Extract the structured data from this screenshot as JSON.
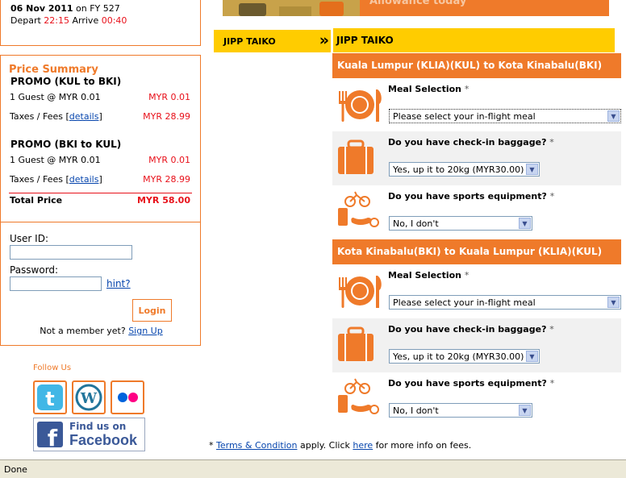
{
  "flight": {
    "date_flight": "06 Nov 2011",
    "on_label": "on",
    "flight_no": "FY 527",
    "depart_label": "Depart",
    "depart_time": "22:15",
    "arrive_label": "Arrive",
    "arrive_time": "00:40"
  },
  "price_summary": {
    "title": "Price Summary",
    "segments": [
      {
        "name": "PROMO (KUL to BKI)",
        "guest_line": "1 Guest @ MYR 0.01",
        "guest_price": "MYR 0.01",
        "taxes_label": "Taxes / Fees [",
        "details_link": "details",
        "taxes_close": "]",
        "taxes_price": "MYR 28.99"
      },
      {
        "name": "PROMO (BKI to KUL)",
        "guest_line": "1 Guest @ MYR 0.01",
        "guest_price": "MYR 0.01",
        "taxes_label": "Taxes / Fees [",
        "details_link": "details",
        "taxes_close": "]",
        "taxes_price": "MYR 28.99"
      }
    ],
    "total_label": "Total Price",
    "total_value": "MYR 58.00"
  },
  "login": {
    "userid_label": "User ID:",
    "userid_value": "",
    "password_label": "Password:",
    "password_value": "",
    "hint_link": "hint?",
    "login_button": "Login",
    "not_member": "Not a member yet?",
    "signup_link": "Sign Up"
  },
  "follow": {
    "label": "Follow Us",
    "facebook_line1": "Find us on",
    "facebook_line2": "Facebook"
  },
  "banner_text": "Allowance today",
  "passenger_tab": {
    "name": "JIPP TAIKO",
    "chevron": "»"
  },
  "passenger_header": "JIPP TAIKO",
  "segments": [
    {
      "title": "Kuala Lumpur (KLIA)(KUL) to Kota Kinabalu(BKI)",
      "meal_q": "Meal Selection",
      "meal_value": "Please select your in-flight meal",
      "baggage_q": "Do you have check-in baggage?",
      "baggage_value": "Yes, up it to 20kg (MYR30.00)",
      "sports_q": "Do you have sports equipment?",
      "sports_value": "No, I don't"
    },
    {
      "title": "Kota Kinabalu(BKI) to Kuala Lumpur (KLIA)(KUL)",
      "meal_q": "Meal Selection",
      "meal_value": "Please select your in-flight meal",
      "baggage_q": "Do you have check-in baggage?",
      "baggage_value": "Yes, up it to 20kg (MYR30.00)",
      "sports_q": "Do you have sports equipment?",
      "sports_value": "No, I don't"
    }
  ],
  "required_mark": "*",
  "terms": {
    "prefix": "* ",
    "link1": "Terms & Condition",
    "middle": " apply. Click ",
    "link2": "here",
    "suffix": " for more info on fees."
  },
  "status_text": "Done",
  "colors": {
    "accent": "#ef7a2a",
    "yellow": "#ffcc00",
    "price_red": "#e8101a"
  }
}
